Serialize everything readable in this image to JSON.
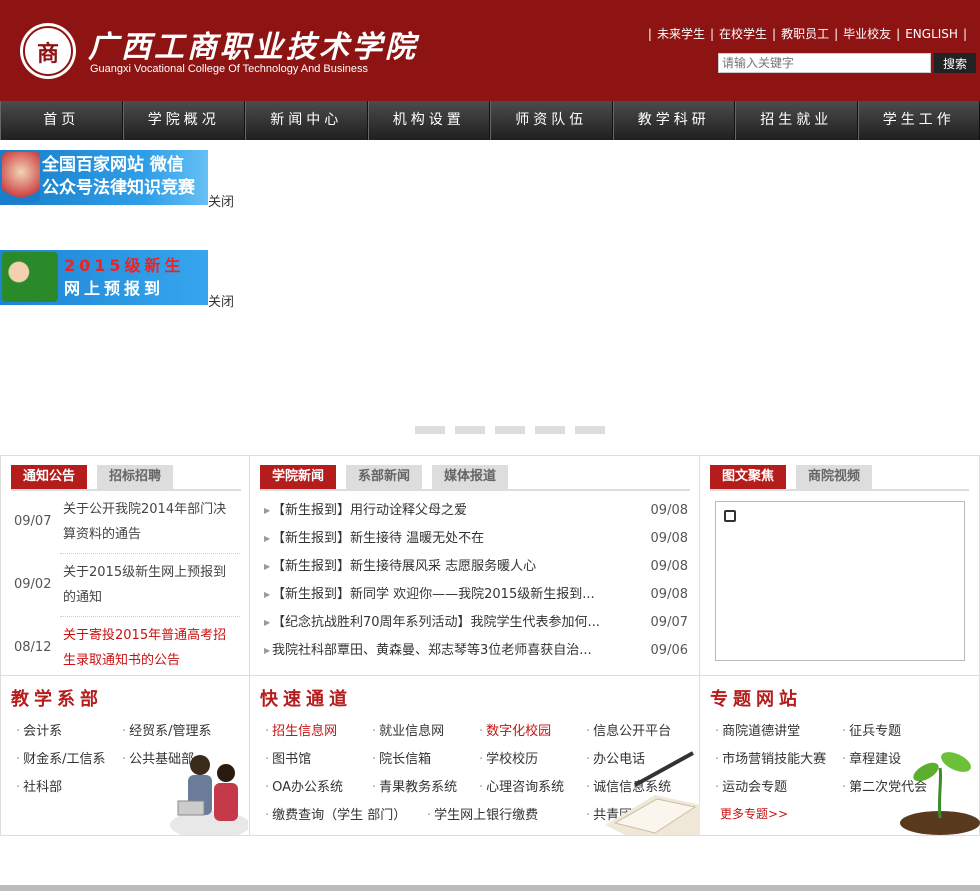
{
  "header": {
    "logo_seal_char": "商",
    "title_cn": "广西工商职业技术学院",
    "title_en": "Guangxi  Vocational College Of Technology And Business",
    "top_links": [
      "未来学生",
      "在校学生",
      "教职员工",
      "毕业校友",
      "ENGLISH"
    ],
    "search": {
      "placeholder": "请输入关键字",
      "button": "搜索"
    }
  },
  "nav": [
    "首页",
    "学院概况",
    "新闻中心",
    "机构设置",
    "师资队伍",
    "教学科研",
    "招生就业",
    "学生工作"
  ],
  "float_ads": [
    {
      "line1": "全国百家网站 微信",
      "line2": "公众号法律知识竞赛",
      "close": "关闭"
    },
    {
      "line1": "2015级新生",
      "line2": "网上预报到",
      "close": "关闭"
    }
  ],
  "notices": {
    "tabs": [
      "通知公告",
      "招标招聘"
    ],
    "items": [
      {
        "date": "09/07",
        "title": "关于公开我院2014年部门决算资料的通告",
        "highlight": false
      },
      {
        "date": "09/02",
        "title": "关于2015级新生网上预报到的通知",
        "highlight": false
      },
      {
        "date": "08/12",
        "title": "关于寄投2015年普通高考招生录取通知书的公告",
        "highlight": true
      }
    ]
  },
  "news": {
    "tabs": [
      "学院新闻",
      "系部新闻",
      "媒体报道"
    ],
    "items": [
      {
        "title": "【新生报到】用行动诠释父母之爱",
        "date": "09/08"
      },
      {
        "title": "【新生报到】新生接待 温暖无处不在",
        "date": "09/08"
      },
      {
        "title": "【新生报到】新生接待展风采 志愿服务暖人心",
        "date": "09/08"
      },
      {
        "title": "【新生报到】新同学 欢迎你——我院2015级新生报到...",
        "date": "09/08"
      },
      {
        "title": "【纪念抗战胜利70周年系列活动】我院学生代表参加何...",
        "date": "09/07"
      },
      {
        "title": "我院社科部覃田、黄森曼、郑志琴等3位老师喜获自治...",
        "date": "09/06"
      }
    ]
  },
  "photo": {
    "tabs": [
      "图文聚焦",
      "商院视频"
    ]
  },
  "departments": {
    "title": "教学系部",
    "items": [
      "会计系",
      "经贸系/管理系",
      "财金系/工信系",
      "公共基础部",
      "社科部"
    ]
  },
  "quick": {
    "title": "快速通道",
    "items": [
      {
        "label": "招生信息网",
        "red": true
      },
      {
        "label": "就业信息网",
        "red": false
      },
      {
        "label": "数字化校园",
        "red": true
      },
      {
        "label": "信息公开平台",
        "red": false
      },
      {
        "label": "图书馆",
        "red": false
      },
      {
        "label": "院长信箱",
        "red": false
      },
      {
        "label": "学校校历",
        "red": false
      },
      {
        "label": "办公电话",
        "red": false
      },
      {
        "label": "OA办公系统",
        "red": false
      },
      {
        "label": "青果教务系统",
        "red": false
      },
      {
        "label": "心理咨询系统",
        "red": false
      },
      {
        "label": "诚信信息系统",
        "red": false
      },
      {
        "label": "缴费查询（学生 部门）",
        "red": false
      },
      {
        "label": "学生网上银行缴费",
        "red": false
      },
      {
        "label": "共青团",
        "red": false
      }
    ]
  },
  "topics": {
    "title": "专题网站",
    "items": [
      "商院道德讲堂",
      "征兵专题",
      "市场营销技能大赛",
      "章程建设",
      "运动会专题",
      "第二次党代会"
    ],
    "more": "更多专题>>"
  },
  "colors": {
    "brand_red": "#8e1414",
    "accent_red": "#b51d1d",
    "nav_dark": "#2b2b2b"
  }
}
